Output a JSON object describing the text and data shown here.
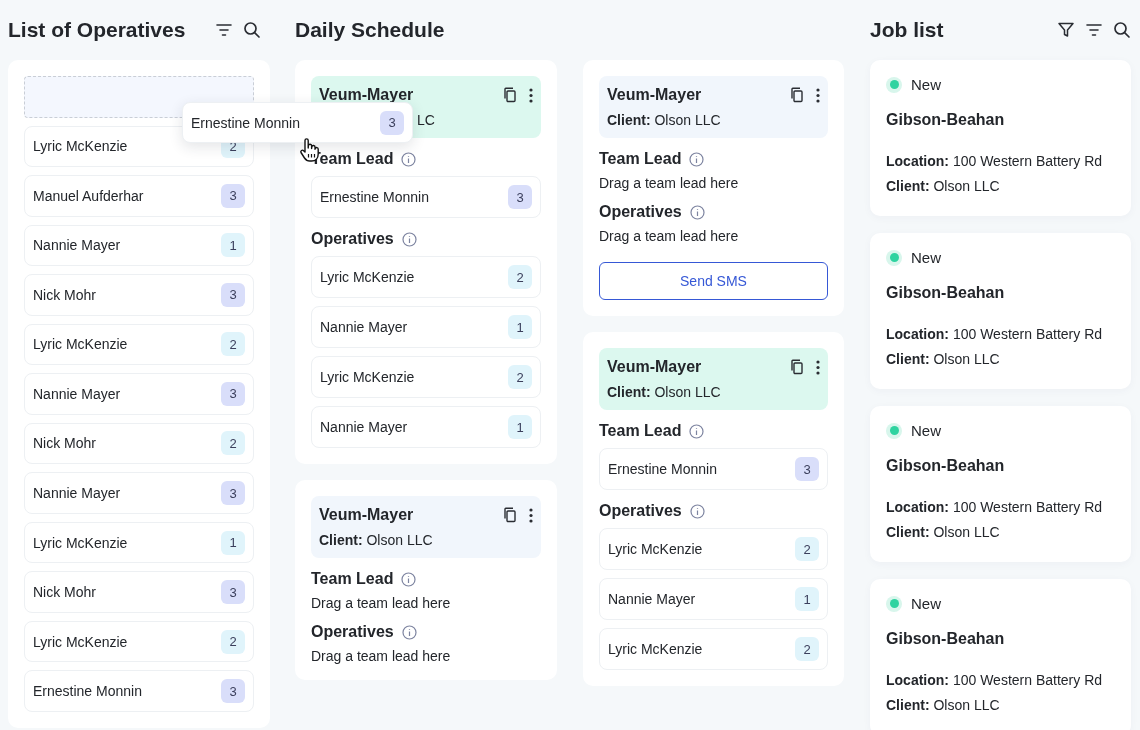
{
  "operatives_panel": {
    "title": "List of Operatives",
    "operatives": [
      {
        "name": "Lyric McKenzie",
        "count": "2",
        "color": "#e0f4fb"
      },
      {
        "name": "Manuel Aufderhar",
        "count": "3",
        "color": "#d9defa"
      },
      {
        "name": "Nannie Mayer",
        "count": "1",
        "color": "#e0f4fb"
      },
      {
        "name": "Nick Mohr",
        "count": "3",
        "color": "#d9defa"
      },
      {
        "name": "Lyric McKenzie",
        "count": "2",
        "color": "#e0f4fb"
      },
      {
        "name": "Nannie Mayer",
        "count": "3",
        "color": "#d9defa"
      },
      {
        "name": "Nick Mohr",
        "count": "2",
        "color": "#e0f4fb"
      },
      {
        "name": "Nannie Mayer",
        "count": "3",
        "color": "#d9defa"
      },
      {
        "name": "Lyric McKenzie",
        "count": "1",
        "color": "#e0f4fb"
      },
      {
        "name": "Nick Mohr",
        "count": "3",
        "color": "#d9defa"
      },
      {
        "name": "Lyric McKenzie",
        "count": "2",
        "color": "#e0f4fb"
      },
      {
        "name": "Ernestine Monnin",
        "count": "3",
        "color": "#d9defa"
      }
    ]
  },
  "dragged_operative": {
    "name": "Ernestine Monnin",
    "count": "3",
    "color": "#d9defa"
  },
  "daily_schedule": {
    "title": "Daily Schedule",
    "columns": [
      [
        {
          "header": {
            "title": "Veum-Mayer",
            "client_value": "LC",
            "color": "#dcf8ef"
          },
          "sections": [
            {
              "title": "Team Lead",
              "items": [
                {
                  "name": "Ernestine Monnin",
                  "count": "3",
                  "color": "#d9defa"
                }
              ]
            },
            {
              "title": "Operatives",
              "items": [
                {
                  "name": "Lyric McKenzie",
                  "count": "2",
                  "color": "#e0f4fb"
                },
                {
                  "name": "Nannie Mayer",
                  "count": "1",
                  "color": "#e0f4fb"
                },
                {
                  "name": "Lyric McKenzie",
                  "count": "2",
                  "color": "#e0f4fb"
                },
                {
                  "name": "Nannie Mayer",
                  "count": "1",
                  "color": "#e0f4fb"
                }
              ]
            }
          ]
        },
        {
          "header": {
            "title": "Veum-Mayer",
            "client_label": "Client:",
            "client_value": "Olson LLC",
            "color": "#f1f6fc"
          },
          "sections": [
            {
              "title": "Team Lead",
              "hint": "Drag a team lead here"
            },
            {
              "title": "Operatives",
              "hint": "Drag a team lead here"
            }
          ]
        }
      ],
      [
        {
          "header": {
            "title": "Veum-Mayer",
            "client_label": "Client:",
            "client_value": "Olson LLC",
            "color": "#f1f6fc"
          },
          "sections": [
            {
              "title": "Team Lead",
              "hint": "Drag a team lead here"
            },
            {
              "title": "Operatives",
              "hint": "Drag a team lead here"
            }
          ],
          "button": "Send SMS"
        },
        {
          "header": {
            "title": "Veum-Mayer",
            "client_label": "Client:",
            "client_value": "Olson LLC",
            "color": "#dcf8ef"
          },
          "sections": [
            {
              "title": "Team Lead",
              "items": [
                {
                  "name": "Ernestine Monnin",
                  "count": "3",
                  "color": "#d9defa"
                }
              ]
            },
            {
              "title": "Operatives",
              "items": [
                {
                  "name": "Lyric McKenzie",
                  "count": "2",
                  "color": "#e0f4fb"
                },
                {
                  "name": "Nannie Mayer",
                  "count": "1",
                  "color": "#e0f4fb"
                },
                {
                  "name": "Lyric McKenzie",
                  "count": "2",
                  "color": "#e0f4fb"
                }
              ]
            }
          ]
        }
      ]
    ]
  },
  "job_list": {
    "title": "Job list",
    "jobs": [
      {
        "status": "New",
        "color": "#2fd3a0",
        "title": "Gibson-Beahan",
        "location_label": "Location:",
        "location": "100 Western Battery Rd",
        "client_label": "Client:",
        "client": "Olson LLC"
      },
      {
        "status": "New",
        "color": "#2fd3a0",
        "title": "Gibson-Beahan",
        "location_label": "Location:",
        "location": "100 Western Battery Rd",
        "client_label": "Client:",
        "client": "Olson LLC"
      },
      {
        "status": "New",
        "color": "#2fd3a0",
        "title": "Gibson-Beahan",
        "location_label": "Location:",
        "location": "100 Western Battery Rd",
        "client_label": "Client:",
        "client": "Olson LLC"
      },
      {
        "status": "New",
        "color": "#2fd3a0",
        "title": "Gibson-Beahan",
        "location_label": "Location:",
        "location": "100 Western Battery Rd",
        "client_label": "Client:",
        "client": "Olson LLC"
      }
    ]
  }
}
